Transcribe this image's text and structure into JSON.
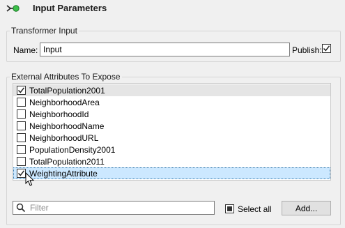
{
  "header": {
    "title": "Input Parameters",
    "icon": "input-port-icon"
  },
  "transformer_input": {
    "legend": "Transformer Input",
    "name_label": "Name:",
    "name_value": "Input",
    "publish_label": "Publish:",
    "publish_checked": true
  },
  "attributes": {
    "legend": "External Attributes To Expose",
    "items": [
      {
        "label": "TotalPopulation2001",
        "checked": true
      },
      {
        "label": "NeighborhoodArea",
        "checked": false
      },
      {
        "label": "NeighborhoodId",
        "checked": false
      },
      {
        "label": "NeighborhoodName",
        "checked": false
      },
      {
        "label": "NeighborhoodURL",
        "checked": false
      },
      {
        "label": "PopulationDensity2001",
        "checked": false
      },
      {
        "label": "TotalPopulation2011",
        "checked": false
      },
      {
        "label": "WeightingAttribute",
        "checked": true
      }
    ],
    "filter_placeholder": "Filter",
    "select_all_label": "Select all",
    "add_label": "Add..."
  },
  "colors": {
    "accent": "#2e9e3e",
    "selection": "#cce8ff"
  }
}
